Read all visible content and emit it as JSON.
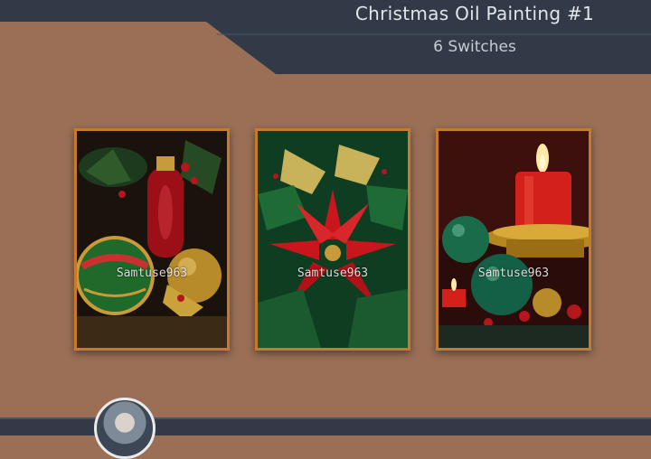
{
  "header": {
    "title": "Christmas Oil Painting #1",
    "subtitle": "6 Switches"
  },
  "colors": {
    "background": "#9a6f55",
    "header_band": "#323a47",
    "card_border": "#c57a2c"
  },
  "cards": [
    {
      "watermark": "Samtuse963",
      "subject": "ornaments-painting"
    },
    {
      "watermark": "Samtuse963",
      "subject": "poinsettia-painting"
    },
    {
      "watermark": "Samtuse963",
      "subject": "candle-painting"
    }
  ]
}
